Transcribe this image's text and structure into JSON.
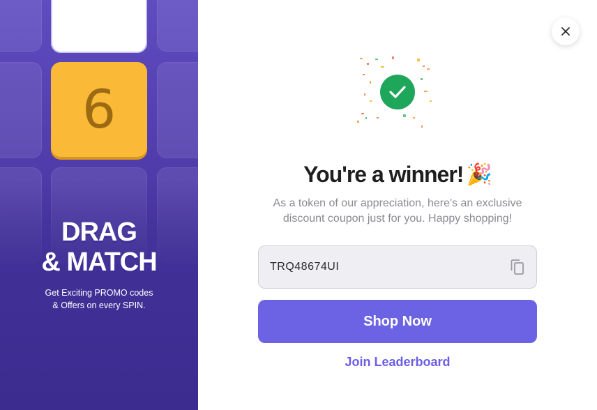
{
  "promo": {
    "tile_number": "6",
    "title_line1": "DRAG",
    "title_line2": "& MATCH",
    "subtitle_line1": "Get Exciting PROMO codes",
    "subtitle_line2": "& Offers on every SPIN."
  },
  "result": {
    "heading": "You're a winner!",
    "heading_emoji": "🎉",
    "description_line1": "As a token of our appreciation, here's an exclusive",
    "description_line2": "discount coupon just for you. Happy shopping!",
    "coupon_code": "TRQ48674UI",
    "shop_button_label": "Shop Now",
    "leaderboard_link_label": "Join Leaderboard"
  },
  "icons": {
    "close": "close-icon",
    "check": "check-icon",
    "copy": "copy-icon",
    "confetti": "confetti-icon"
  },
  "colors": {
    "panel_purple": "#4e3aa8",
    "accent_button": "#6c62e4",
    "success_green": "#1ea65a",
    "tile_yellow": "#fbb938"
  }
}
